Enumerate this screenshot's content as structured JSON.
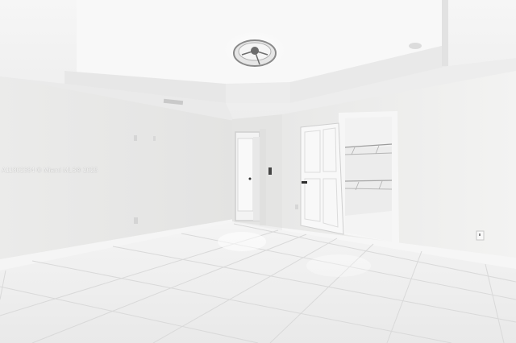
{
  "photo": {
    "watermark": "A11802384 © Miami MLS® 2025"
  },
  "colors": {
    "wall_left": "#e9e9e7",
    "wall_right": "#eeeeec",
    "ceiling": "#f4f4f4",
    "floor": "#f1f1f1",
    "door": "#f7f7f7"
  }
}
